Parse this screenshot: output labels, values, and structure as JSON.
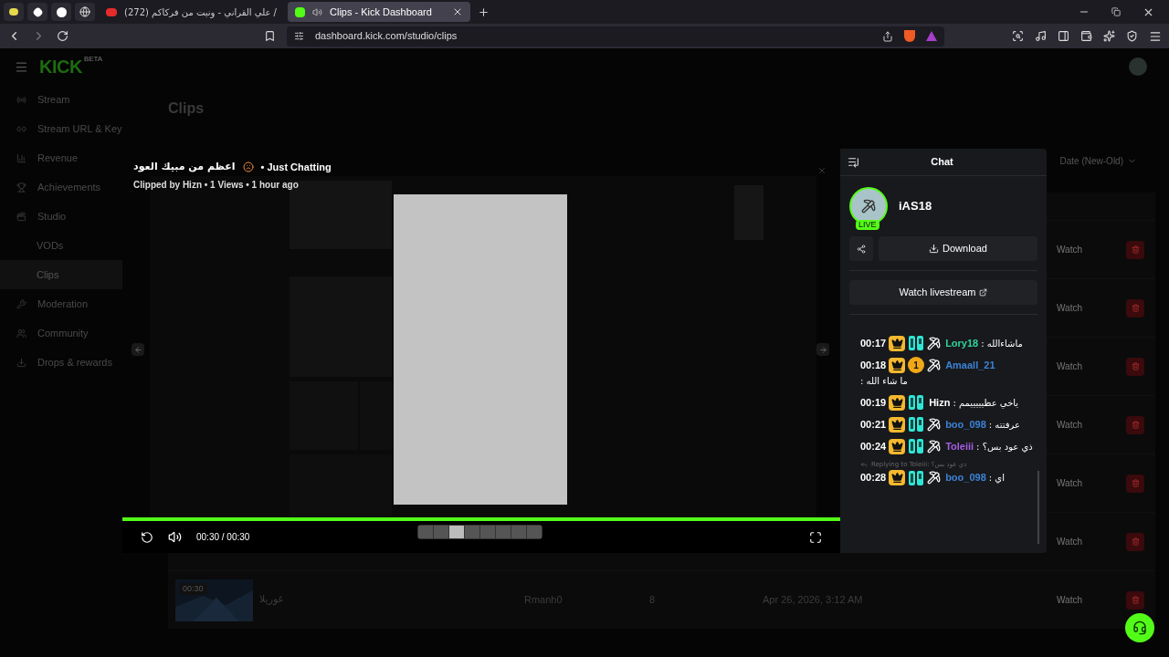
{
  "browser": {
    "tabs": [
      {
        "title": "(272) علي القراني - ونيت من فركاكم /",
        "selected": false
      },
      {
        "title": "Clips - Kick Dashboard",
        "selected": true
      }
    ],
    "url": "dashboard.kick.com/studio/clips"
  },
  "logo": {
    "text": "KICK",
    "tag": "BETA"
  },
  "sidebar": {
    "items": [
      {
        "label": "Stream",
        "selected": false
      },
      {
        "label": "Stream URL & Key",
        "selected": false
      },
      {
        "label": "Revenue",
        "selected": false
      },
      {
        "label": "Achievements",
        "selected": false
      },
      {
        "label": "Studio",
        "selected": false,
        "children": [
          {
            "label": "VODs",
            "selected": false
          },
          {
            "label": "Clips",
            "selected": true
          }
        ]
      },
      {
        "label": "Moderation",
        "selected": false
      },
      {
        "label": "Community",
        "selected": false
      },
      {
        "label": "Drops & rewards",
        "selected": false
      }
    ]
  },
  "page": {
    "title": "Clips",
    "sort": "Date (New-Old)"
  },
  "table": {
    "rows": [
      {
        "action": "Watch"
      },
      {
        "action": "Watch"
      },
      {
        "action": "Watch"
      },
      {
        "action": "Watch"
      },
      {
        "action": "Watch"
      },
      {
        "action": "Watch"
      },
      {
        "duration": "00:30",
        "title": "غوريلا",
        "author": "Rmanh0",
        "views": "8",
        "date": "Apr 26, 2026, 3:12 AM",
        "action": "Watch"
      }
    ]
  },
  "modal": {
    "title": "اعظم من مبيك العود",
    "category": "• Just Chatting",
    "meta": "Clipped by Hizn • 1 Views • 1 hour ago",
    "player": {
      "time": "00:30 / 00:30",
      "level": 1,
      "muted": false,
      "segments": [
        {
          "selected": false
        },
        {
          "selected": false
        },
        {
          "selected": true
        },
        {
          "selected": false
        },
        {
          "selected": false
        },
        {
          "selected": false
        },
        {
          "selected": false
        },
        {
          "selected": false
        }
      ]
    },
    "chat": {
      "title": "Chat",
      "channel": "iAS18",
      "live": "LIVE",
      "download": "Download",
      "watch": "Watch livestream",
      "messages": [
        {
          "time": "00:17",
          "badges": [
            {
              "kind": "crown"
            },
            {
              "kind": "og"
            },
            {
              "kind": "pick"
            }
          ],
          "user": "Lory18",
          "color": "#2fd39a",
          "text": ": ماشاءالله"
        },
        {
          "time": "00:18",
          "badges": [
            {
              "kind": "crown"
            },
            {
              "kind": "coin",
              "text": "1"
            },
            {
              "kind": "pick"
            }
          ],
          "user": "Amaall_21",
          "color": "#3b82d6",
          "text": ": ما شاء الله"
        },
        {
          "time": "00:19",
          "badges": [
            {
              "kind": "crown"
            },
            {
              "kind": "og"
            }
          ],
          "user": "Hizn",
          "color": "#ffffff",
          "text": ": ياخي عظيييييمم"
        },
        {
          "time": "00:21",
          "badges": [
            {
              "kind": "crown"
            },
            {
              "kind": "og"
            },
            {
              "kind": "pick"
            }
          ],
          "user": "boo_098",
          "color": "#3b82d6",
          "text": ": عرفتته"
        },
        {
          "time": "00:24",
          "badges": [
            {
              "kind": "crown"
            },
            {
              "kind": "og"
            },
            {
              "kind": "pick"
            }
          ],
          "user": "Toleiii",
          "color": "#a45ee5",
          "text": ": ذي عود بس؟"
        },
        {
          "time": "00:28",
          "reply": "Replying to Toleiii: ذي عود بس؟",
          "badges": [
            {
              "kind": "crown"
            },
            {
              "kind": "og"
            },
            {
              "kind": "pick"
            }
          ],
          "user": "boo_098",
          "color": "#3b82d6",
          "text": ": اي"
        }
      ]
    }
  }
}
